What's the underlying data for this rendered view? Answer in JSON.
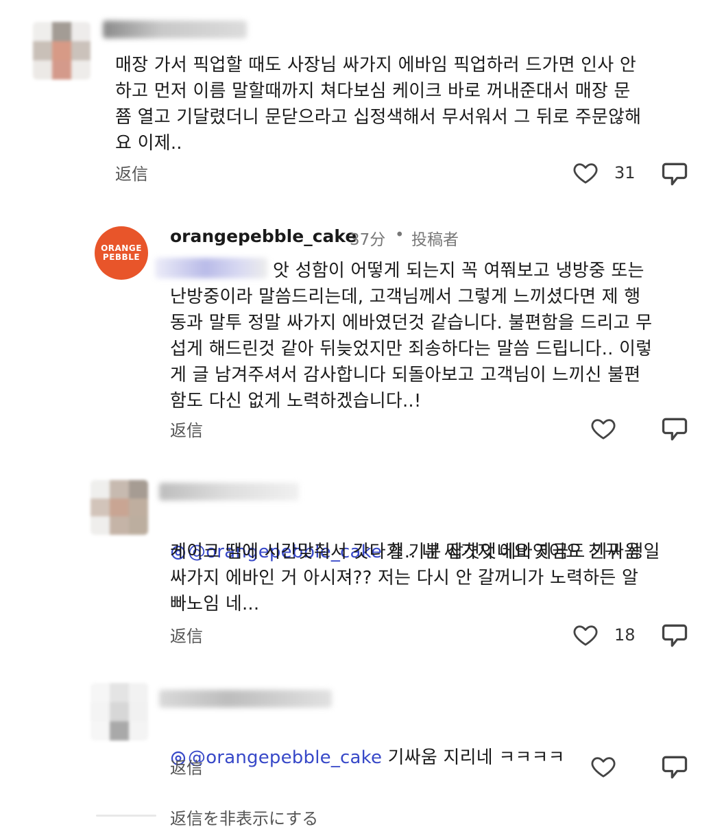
{
  "comment1": {
    "body": "매장 가서 픽업할 때도 사장님 싸가지 에바임 픽업하러 드가면 인사 안\n하고 먼저 이름 말할때까지 쳐다보심 케이크 바로 꺼내준대서 매장 문\n쬼 열고 기달렸더니 문닫으라고 십정색해서 무서워서 그 뒤로 주문않해\n요 이제..",
    "reply_label": "返信",
    "likes": "31"
  },
  "owner_reply": {
    "username": "orangepebble_cake",
    "time": "37分",
    "separator": "•",
    "badge": "投稿者",
    "logo_line1": "ORANGE",
    "logo_line2": "PEBBLE",
    "body": "앗 성함이 어떻게 되는지 꼭 여쭤보고 냉방중 또는\n난방중이라 말씀드리는데, 고객님께서 그렇게 느끼셨다면 제 행\n동과 말투 정말 싸가지 에바였던것 같습니다. 불편함을 드리고 무\n섭게 해드린것 같아 뒤늦었지만 죄송하다는 말씀 드립니다.. 이렇\n게 글 남겨주셔서 감사합니다 되돌아보고 고객님이 느끼신 불편\n함도 다신 없게 노력하겠습니다..!",
    "reply_label": "返信"
  },
  "comment2": {
    "mention": "@orangepebble_cake",
    "body_first": " 헐.. 네 싸가지 에바엿어요 친구 생일",
    "body_rest": "케이크 땜에 시간맞춰서 갓다가 기분 잡쳣엇네요 지금도 기싸움\n싸가지 에바인 거 아시져?? 저는 다시 안 갈꺼니가 노력하든 알\n빠노임 네...",
    "reply_label": "返信",
    "likes": "18"
  },
  "comment3": {
    "mention": "@orangepebble_cake",
    "body": " 기싸움 지리네 ㅋㅋㅋㅋ",
    "reply_label": "返信"
  },
  "hide_replies_label": "返信を非表示にする",
  "colors": {
    "brand_orange": "#e8552a",
    "mention_blue": "#3748c8",
    "muted_text": "#555555"
  },
  "icons": {
    "like": "heart-outline-icon",
    "repost": "repost-bubble-icon",
    "mention_prefix": "threads-logo-icon"
  }
}
